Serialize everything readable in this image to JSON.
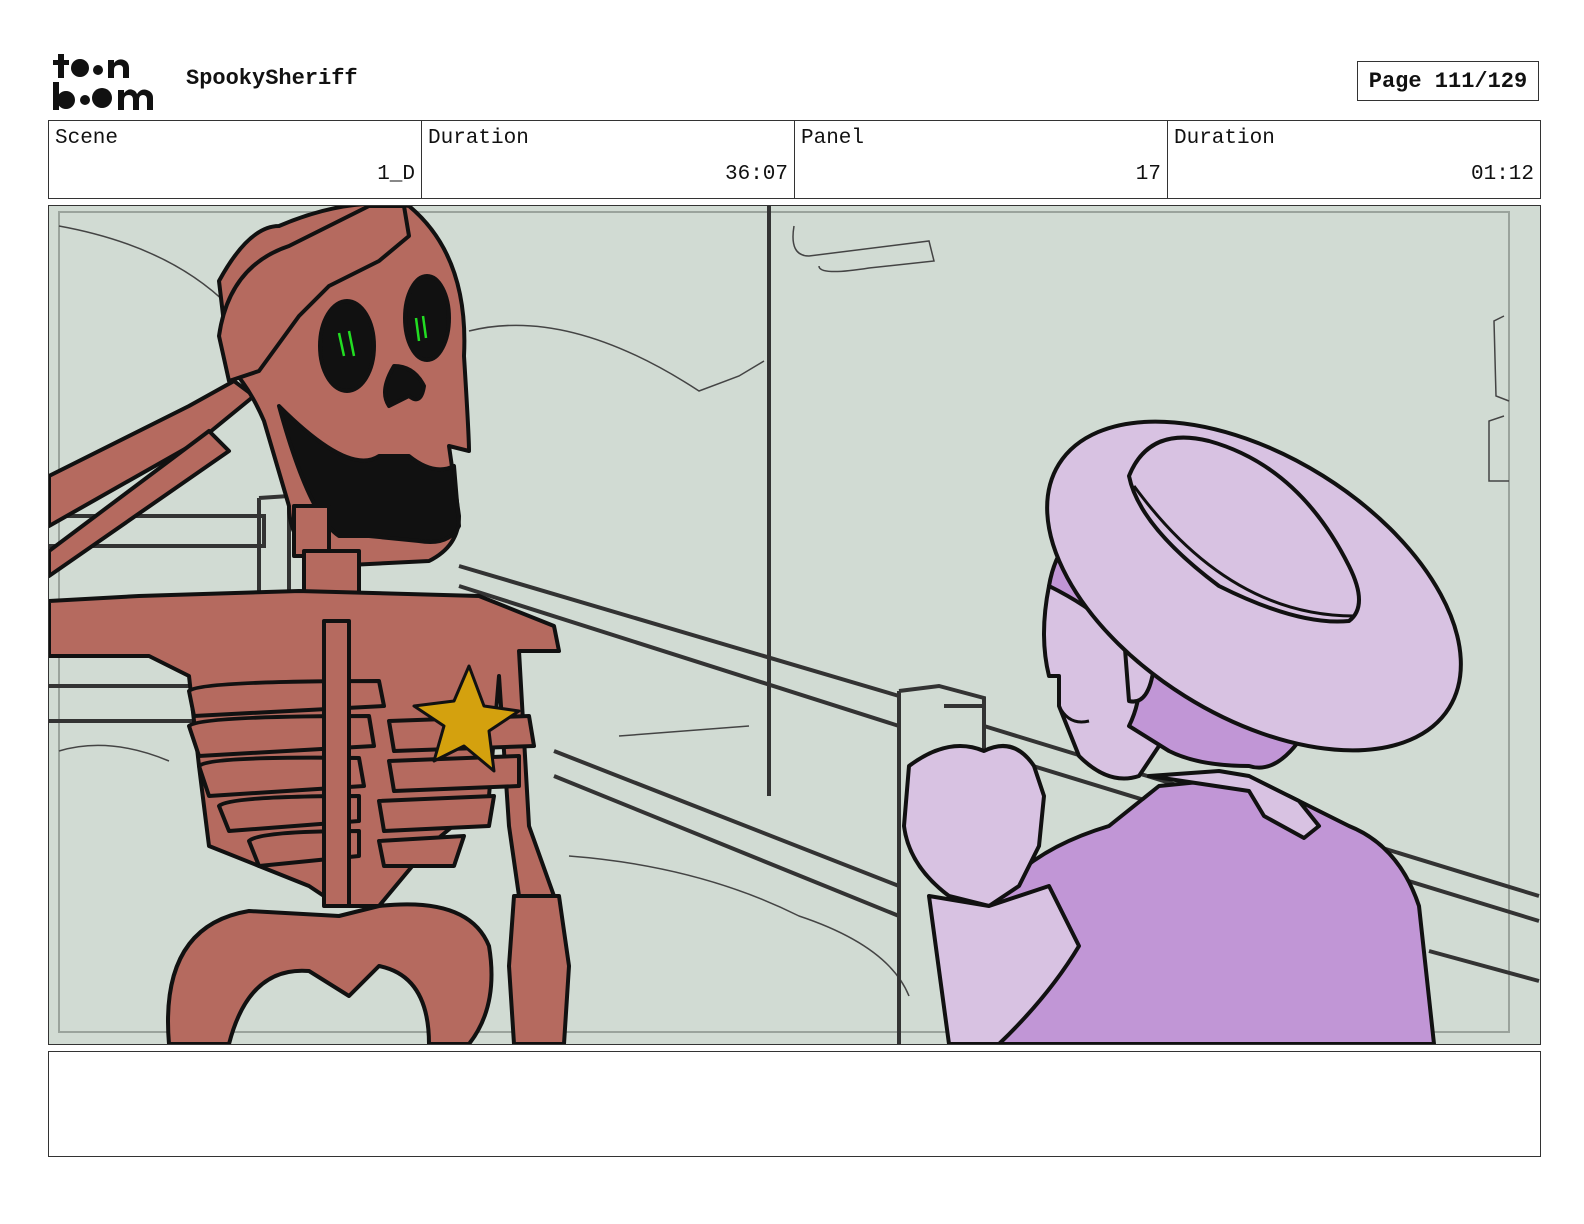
{
  "header": {
    "logo_text": "toon boom",
    "project_title": "SpookySheriff",
    "page_label": "Page 111/129"
  },
  "info": {
    "scene_label": "Scene",
    "scene_value": "1_D",
    "scene_duration_label": "Duration",
    "scene_duration_value": "36:07",
    "panel_label": "Panel",
    "panel_value": "17",
    "panel_duration_label": "Duration",
    "panel_duration_value": "01:12"
  },
  "panel": {
    "background_color": "#d1dbd3",
    "skeleton_color": "#b56a5f",
    "badge_color": "#d4a10e",
    "eye_color": "#22dd22",
    "character_color": "#c196d6"
  },
  "notes": {
    "text": ""
  }
}
